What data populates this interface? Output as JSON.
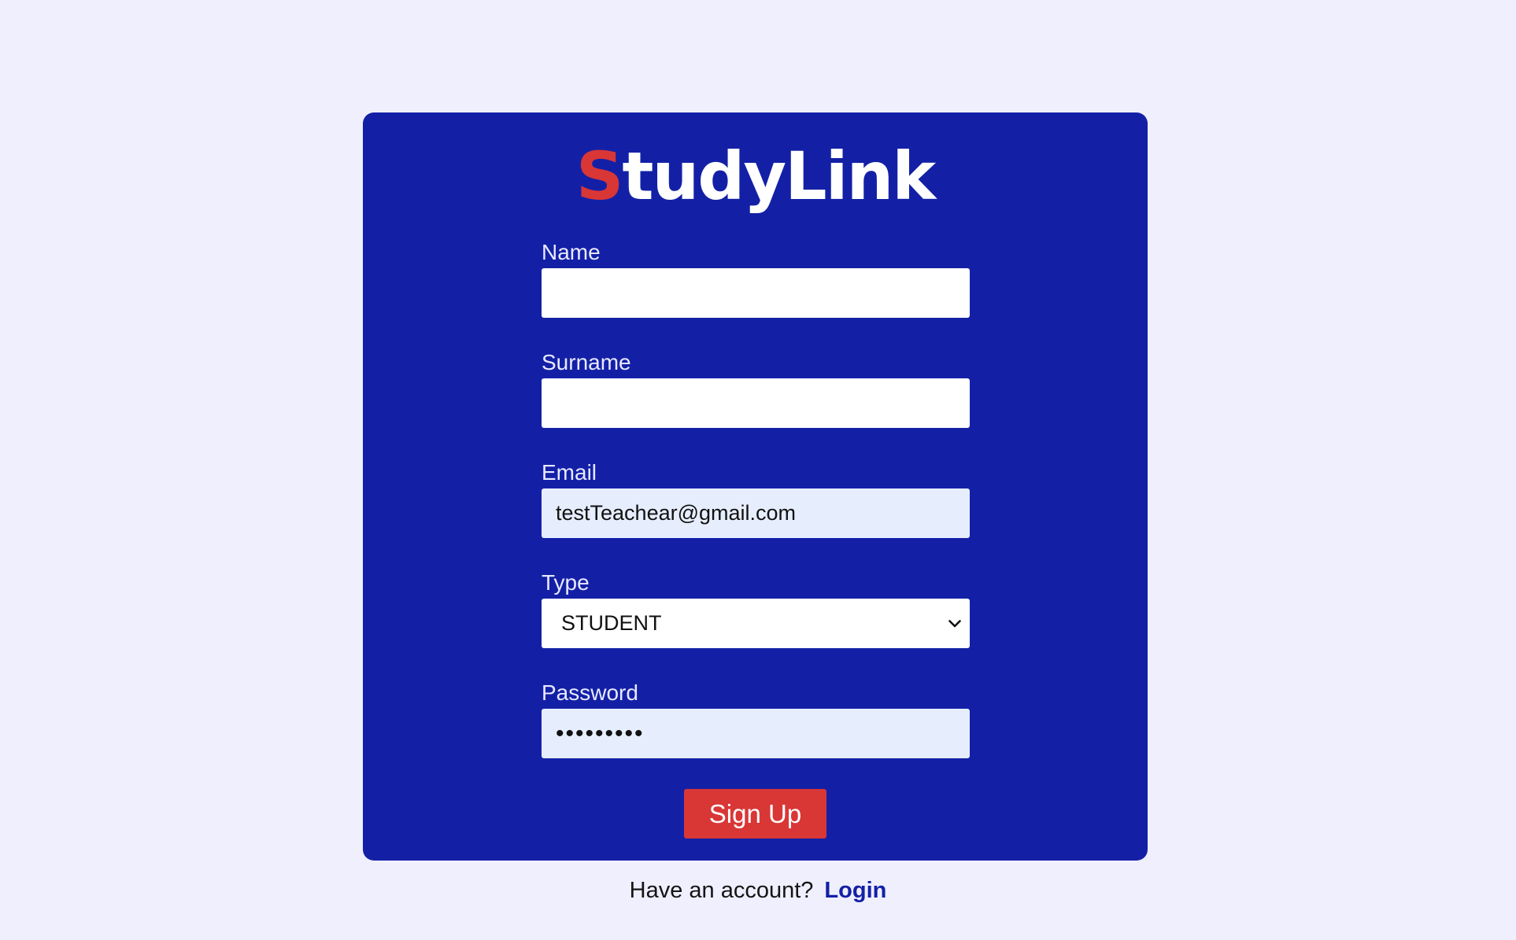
{
  "brand": {
    "first_letter": "S",
    "rest": "tudyLink"
  },
  "form": {
    "name": {
      "label": "Name",
      "value": "",
      "placeholder": ""
    },
    "surname": {
      "label": "Surname",
      "value": "",
      "placeholder": ""
    },
    "email": {
      "label": "Email",
      "value": "testTeachear@gmail.com"
    },
    "type": {
      "label": "Type",
      "selected": "STUDENT"
    },
    "password": {
      "label": "Password",
      "value": "•••••••••"
    },
    "submit_label": "Sign Up"
  },
  "footer": {
    "prompt": "Have an account?",
    "login_label": "Login"
  },
  "colors": {
    "page_background": "#f0effe",
    "card_background": "#1320a6",
    "accent_red": "#d93636",
    "autofill_background": "#e6eefe"
  },
  "icons": {
    "type_dropdown": "chevron-down-icon"
  }
}
